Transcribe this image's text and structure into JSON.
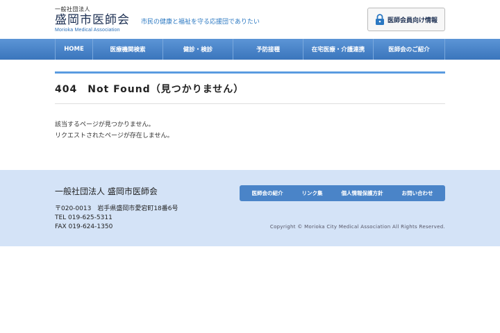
{
  "header": {
    "logo_sub": "一般社団法人",
    "logo_main": "盛岡市医師会",
    "logo_en": "Morioka Medical Association",
    "tagline": "市民の健康と福祉を守る応援団でありたい",
    "member_button": "医師会員向け情報"
  },
  "nav": {
    "items": [
      {
        "label": "HOME"
      },
      {
        "label": "医療機関検索"
      },
      {
        "label": "健診・検診"
      },
      {
        "label": "予防接種"
      },
      {
        "label": "在宅医療・介護連携"
      },
      {
        "label": "医師会のご紹介"
      }
    ]
  },
  "main": {
    "title": "404　Not Found（見つかりません）",
    "message_line1": "該当するページが見つかりません。",
    "message_line2": "リクエストされたページが存在しません。"
  },
  "footer": {
    "org": "一般社団法人 盛岡市医師会",
    "address": "〒020-0013　岩手県盛岡市愛宕町18番6号",
    "tel": "TEL 019-625-5311",
    "fax": "FAX 019-624-1350",
    "nav": [
      {
        "label": "医師会の紹介"
      },
      {
        "label": "リンク集"
      },
      {
        "label": "個人情報保護方針"
      },
      {
        "label": "お問い合わせ"
      }
    ],
    "copyright": "Copyright © Morioka City Medical Association All Rights Reserved."
  },
  "colors": {
    "nav_blue": "#3a75bc",
    "accent_blue": "#5a9be0",
    "footer_bg": "#d4e3f7"
  }
}
